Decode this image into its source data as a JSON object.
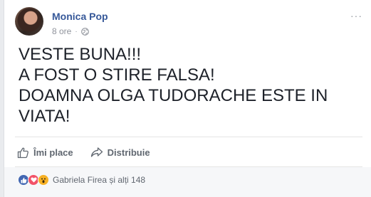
{
  "post": {
    "author": "Monica Pop",
    "time": "8 ore",
    "separator": "·",
    "more_label": "···",
    "lines": [
      "VESTE BUNA!!!",
      "A FOST O STIRE FALSA!",
      "DOAMNA OLGA TUDORACHE ESTE IN",
      "VIATA!"
    ]
  },
  "actions": {
    "like_label": "Îmi place",
    "share_label": "Distribuie"
  },
  "reactions": {
    "summary": "Gabriela Firea și alți 148",
    "icons": [
      "like-icon",
      "love-icon",
      "wow-icon"
    ]
  },
  "colors": {
    "author": "#365899",
    "meta": "#90949c",
    "text": "#1d2129",
    "like": "#4267b2",
    "love": "#f25268",
    "wow": "#f7b125"
  }
}
